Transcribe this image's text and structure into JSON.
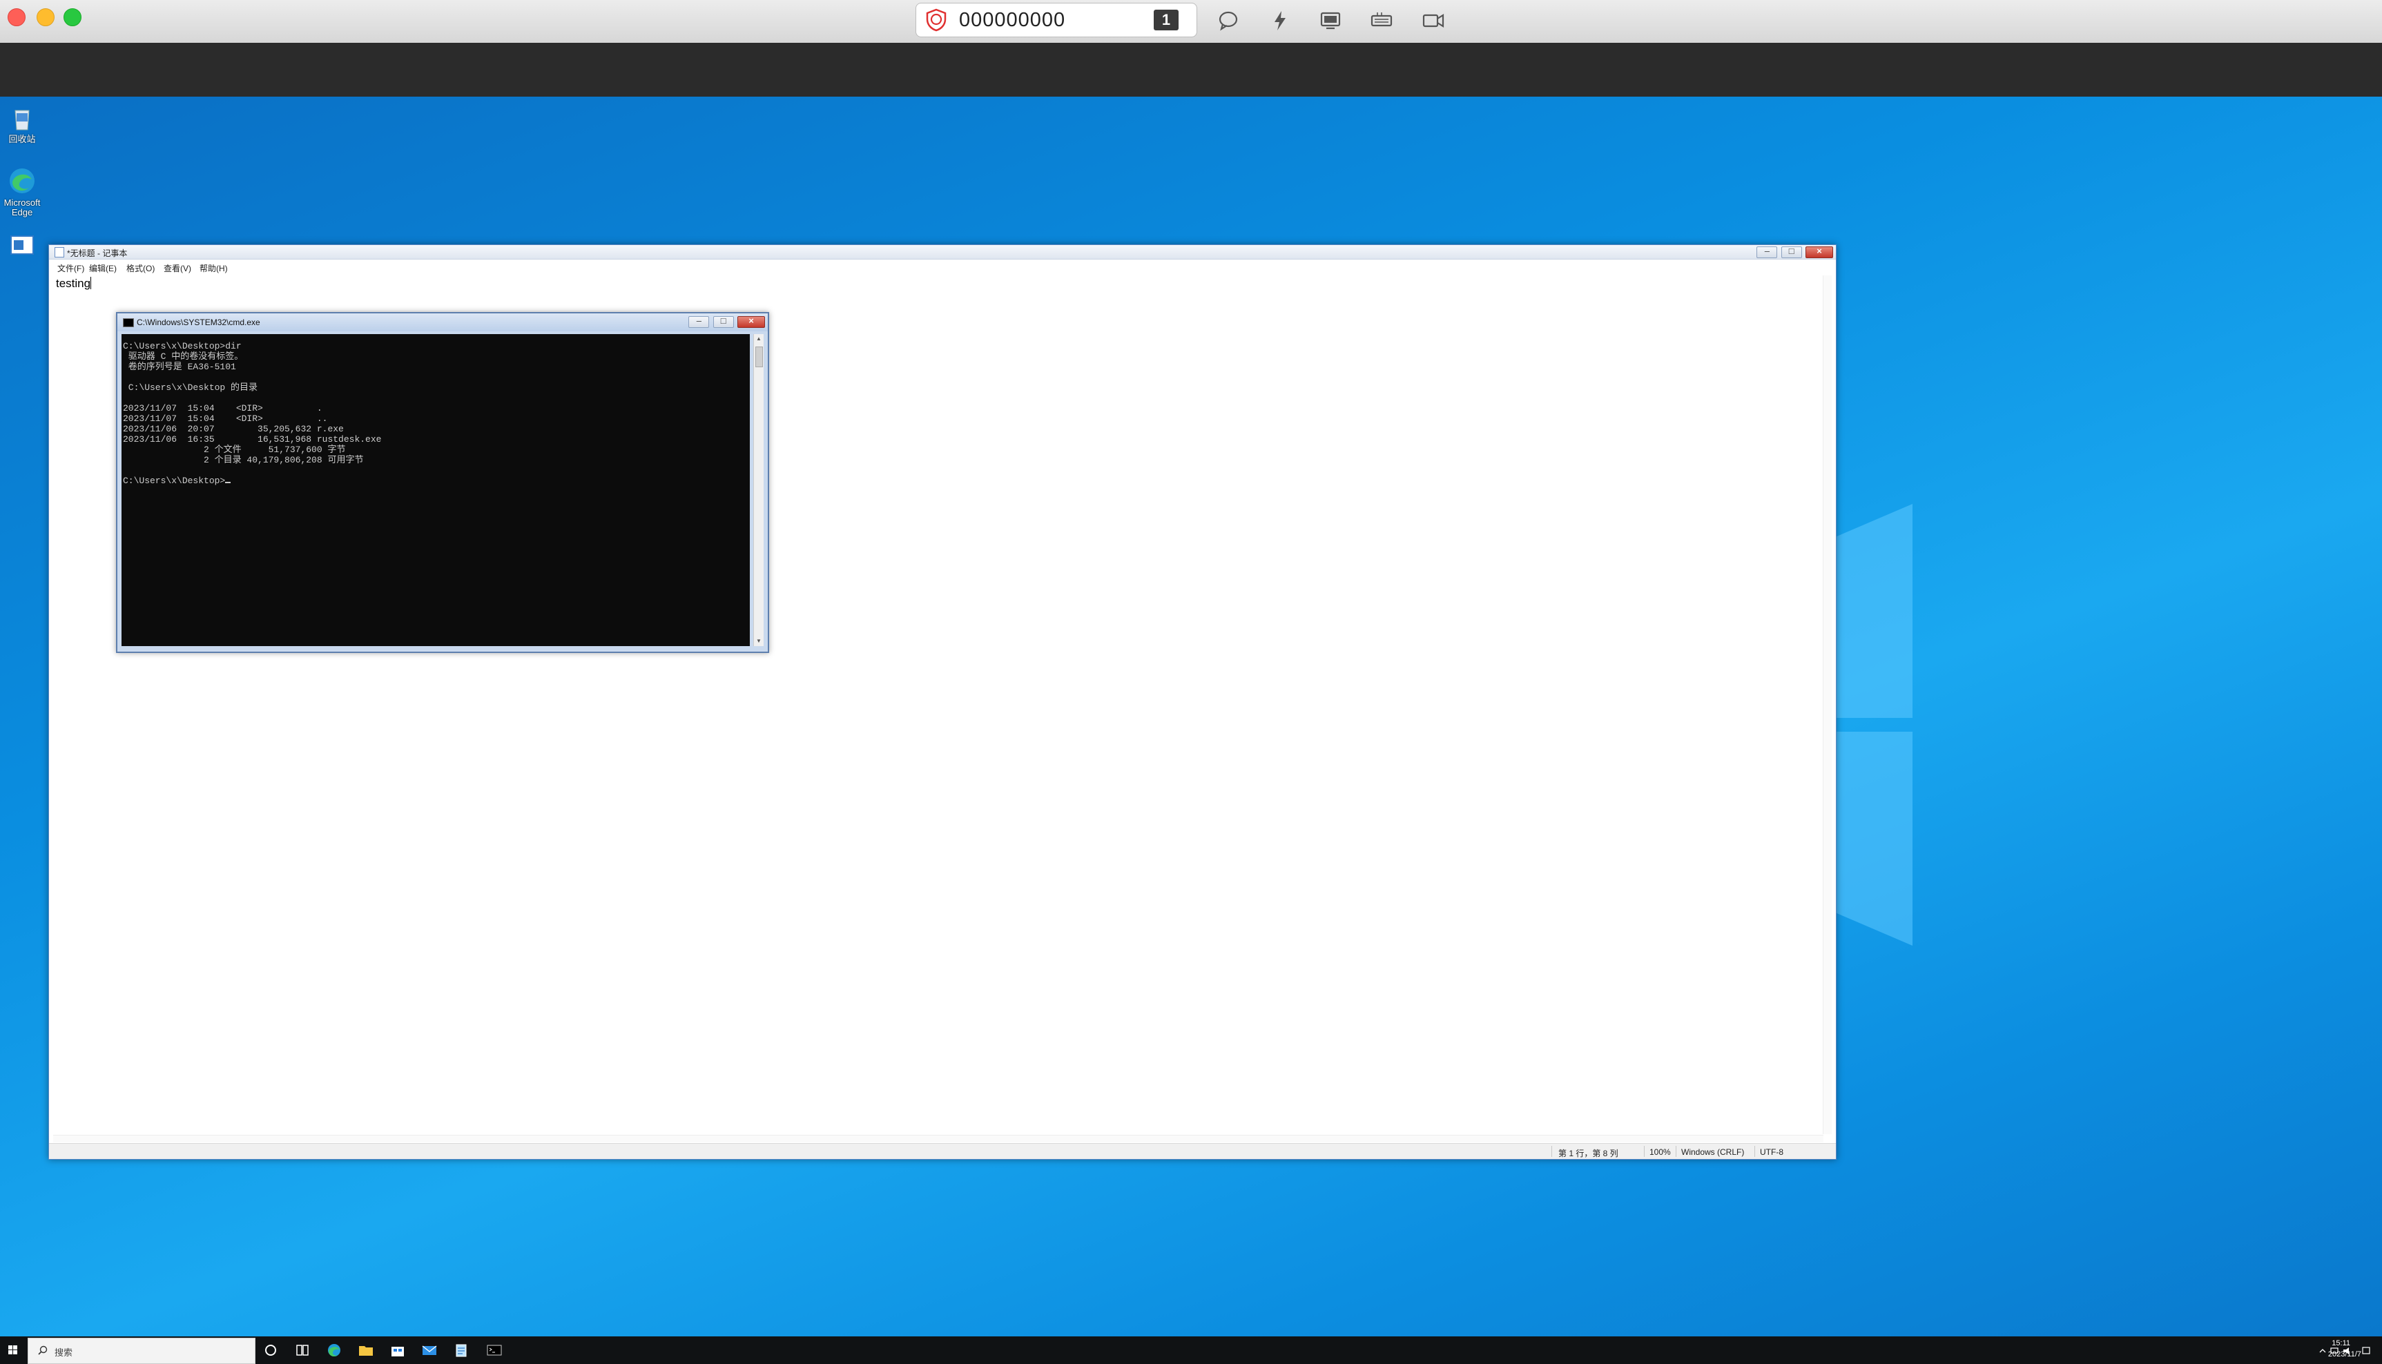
{
  "remote_toolbar": {
    "peer_id": "000000000",
    "monitor_index": "1"
  },
  "desktop": {
    "icons": [
      {
        "label": "回收站"
      },
      {
        "label": "Microsoft Edge"
      },
      {
        "label": ""
      }
    ]
  },
  "notepad": {
    "title": "*无标题 - 记事本",
    "menu": [
      "文件(F)",
      "编辑(E)",
      "格式(O)",
      "查看(V)",
      "帮助(H)"
    ],
    "content": "testing",
    "status": {
      "position": "第 1 行，第 8 列",
      "zoom": "100%",
      "line_ending": "Windows (CRLF)",
      "encoding": "UTF-8"
    }
  },
  "cmd": {
    "title": "C:\\Windows\\SYSTEM32\\cmd.exe",
    "output": "C:\\Users\\x\\Desktop>dir\n 驱动器 C 中的卷没有标签。\n 卷的序列号是 EA36-5101\n\n C:\\Users\\x\\Desktop 的目录\n\n2023/11/07  15:04    <DIR>          .\n2023/11/07  15:04    <DIR>          ..\n2023/11/06  20:07        35,205,632 r.exe\n2023/11/06  16:35        16,531,968 rustdesk.exe\n               2 个文件     51,737,600 字节\n               2 个目录 40,179,806,208 可用字节\n\nC:\\Users\\x\\Desktop>"
  },
  "taskbar": {
    "search_placeholder": "搜索",
    "time": "15:11",
    "date": "2023/11/7"
  }
}
